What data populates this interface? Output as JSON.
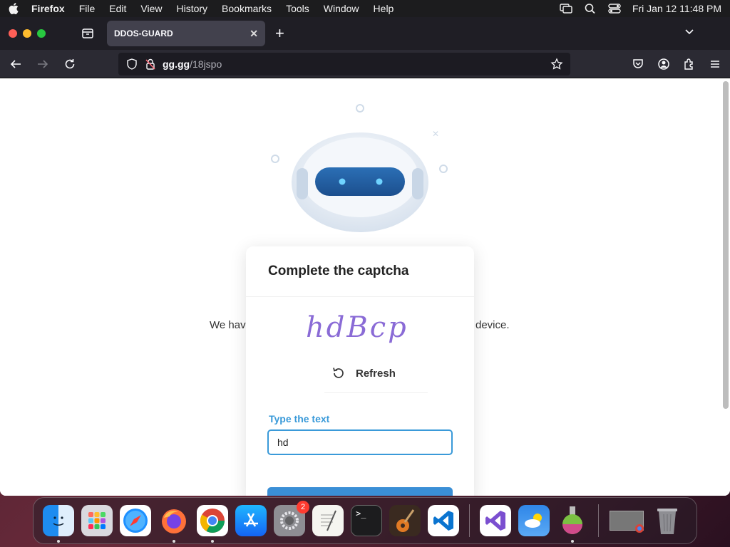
{
  "menubar": {
    "app_name": "Firefox",
    "items": [
      "File",
      "Edit",
      "View",
      "History",
      "Bookmarks",
      "Tools",
      "Window",
      "Help"
    ],
    "clock": "Fri Jan 12  11:48 PM"
  },
  "browser": {
    "tab_title": "DDOS-GUARD",
    "url_host": "gg.gg",
    "url_path": "/18jspo"
  },
  "page": {
    "bg_text_left": "We hav",
    "bg_text_right": "device.",
    "captcha": {
      "title": "Complete the captcha",
      "captcha_text": "hdBcp",
      "refresh_label": "Refresh",
      "field_label": "Type the text",
      "input_value": "hd"
    }
  },
  "dock": {
    "settings_badge": "2"
  },
  "colors": {
    "accent": "#3a9ad9",
    "button": "#3a8fd6"
  }
}
